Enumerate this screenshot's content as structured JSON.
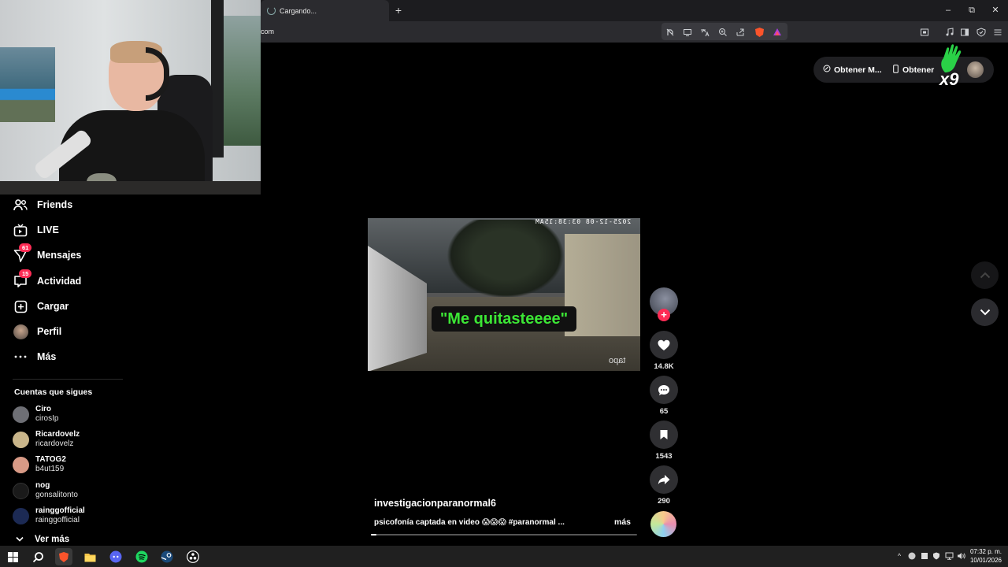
{
  "browser": {
    "tab_title": "Cargando...",
    "new_tab_symbol": "+",
    "url": "com",
    "window_controls": {
      "minimize": "–",
      "restore": "⧉",
      "close": "✕"
    },
    "toolbar_icons": [
      "no-script-icon",
      "cast-icon",
      "translate-icon",
      "zoom-icon",
      "share-icon",
      "brave-shield-icon",
      "rewards-icon",
      "screenshot-icon",
      "music-icon",
      "sidebar-icon",
      "vpn-icon",
      "menu-icon"
    ]
  },
  "sidebar": {
    "items": [
      {
        "label": "Friends",
        "icon": "friends-icon"
      },
      {
        "label": "LIVE",
        "icon": "live-icon"
      },
      {
        "label": "Mensajes",
        "icon": "messages-icon",
        "badge": "61"
      },
      {
        "label": "Actividad",
        "icon": "activity-icon",
        "badge": "15"
      },
      {
        "label": "Cargar",
        "icon": "upload-icon"
      },
      {
        "label": "Perfil",
        "icon": "profile-avatar"
      },
      {
        "label": "Más",
        "icon": "more-icon"
      }
    ],
    "following_title": "Cuentas que sigues",
    "following": [
      {
        "name": "Ciro",
        "username": "cirosIp",
        "color": "#6e6f75"
      },
      {
        "name": "Ricardovelz",
        "username": "ricardovelz",
        "color": "#c9b58a"
      },
      {
        "name": "TATOG2",
        "username": "b4ut159",
        "color": "#d89a86"
      },
      {
        "name": "nog",
        "username": "gonsalitonto",
        "color": "#1a1a1a"
      },
      {
        "name": "rainggofficial",
        "username": "rainggofficial",
        "color": "#1c2a54"
      }
    ],
    "see_more": "Ver más"
  },
  "top_right": {
    "get_app_1": "Obtener M...",
    "get_app_2": "Obtener",
    "overlay_multiplier": "x9"
  },
  "video": {
    "timestamp": "2025-12-08 03:38:15AM",
    "watermark": "tapo",
    "caption": "\"Me quitasteeee\"",
    "author": "investigacionparanormal6",
    "description": "psicofonía captada en video 😱😱😱 #paranormal ...",
    "more_label": "más",
    "progress": 0.02
  },
  "actions": {
    "likes": "14.8K",
    "comments": "65",
    "saves": "1543",
    "shares": "290"
  },
  "taskbar": {
    "apps": [
      "windows-start-icon",
      "search-icon",
      "brave-app-icon",
      "file-explorer-icon",
      "discord-icon",
      "spotify-icon",
      "steam-icon",
      "obs-icon"
    ],
    "time": "07:32 p. m.",
    "date": "10/01/2026"
  },
  "colors": {
    "accent": "#fe2c55",
    "caption_text": "#3ce635",
    "chrome_bg": "#2b2b2f",
    "taskbar_bg": "#202020"
  }
}
